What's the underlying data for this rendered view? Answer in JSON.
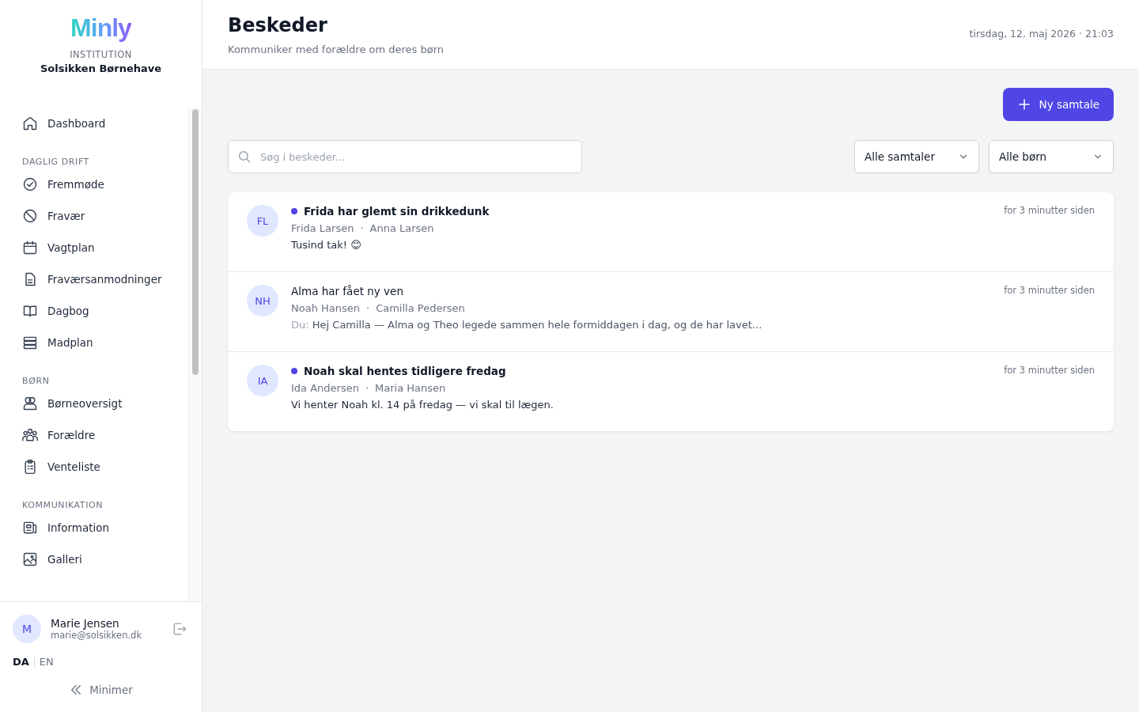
{
  "sidebar": {
    "logo": "Minly",
    "institution_label": "INSTITUTION",
    "institution_name": "Solsikken Børnehave",
    "sections": [
      {
        "items": [
          {
            "label": "Dashboard",
            "selected": false
          }
        ]
      },
      {
        "title": "DAGLIG DRIFT",
        "items": [
          {
            "label": "Fremmøde",
            "selected": false
          },
          {
            "label": "Fravær",
            "selected": false
          },
          {
            "label": "Vagtplan",
            "selected": false
          },
          {
            "label": "Fraværsanmodninger",
            "selected": false
          },
          {
            "label": "Dagbog",
            "selected": false
          },
          {
            "label": "Madplan",
            "selected": false
          }
        ]
      },
      {
        "title": "BØRN",
        "items": [
          {
            "label": "Børneoversigt",
            "selected": false
          },
          {
            "label": "Forældre",
            "selected": false
          },
          {
            "label": "Venteliste",
            "selected": false
          }
        ]
      },
      {
        "title": "KOMMUNIKATION",
        "items": [
          {
            "label": "Information",
            "selected": false
          },
          {
            "label": "Galleri",
            "selected": false
          }
        ]
      }
    ],
    "user": {
      "initial": "M",
      "name": "Marie Jensen",
      "email": "marie@solsikken.dk"
    },
    "languages": [
      {
        "label": "DA",
        "selected": true
      },
      {
        "label": "EN",
        "selected": false
      }
    ],
    "collapse_label": "Minimer"
  },
  "header": {
    "title": "Beskeder",
    "subtitle": "Kommuniker med forældre om deres børn",
    "datetime": "tirsdag, 12. maj 2026 · 21:03"
  },
  "new_button": "Ny samtale",
  "search": {
    "placeholder": "Søg i beskeder..."
  },
  "filters": [
    "Alle samtaler",
    "Alle børn"
  ],
  "conversations": [
    {
      "initials": "FL",
      "unread": true,
      "title": "Frida har glemt sin drikkedunk",
      "child": "Frida Larsen",
      "separator": "·",
      "parent": "Anna Larsen",
      "preview": "Tusind tak! 😊",
      "time": "for 3 minutter siden"
    },
    {
      "initials": "NH",
      "unread": false,
      "title": "Alma har fået ny ven",
      "child": "Noah Hansen",
      "separator": "·",
      "parent": "Camilla Pedersen",
      "sender": "Du:",
      "preview": "Hej Camilla — Alma og Theo legede sammen hele formiddagen i dag, og de har lavet...",
      "time": "for 3 minutter siden"
    },
    {
      "initials": "IA",
      "unread": true,
      "title": "Noah skal hentes tidligere fredag",
      "child": "Ida Andersen",
      "separator": "·",
      "parent": "Maria Hansen",
      "preview": "Vi henter Noah kl. 14 på fredag — vi skal til lægen.",
      "time": "for 3 minutter siden"
    }
  ]
}
